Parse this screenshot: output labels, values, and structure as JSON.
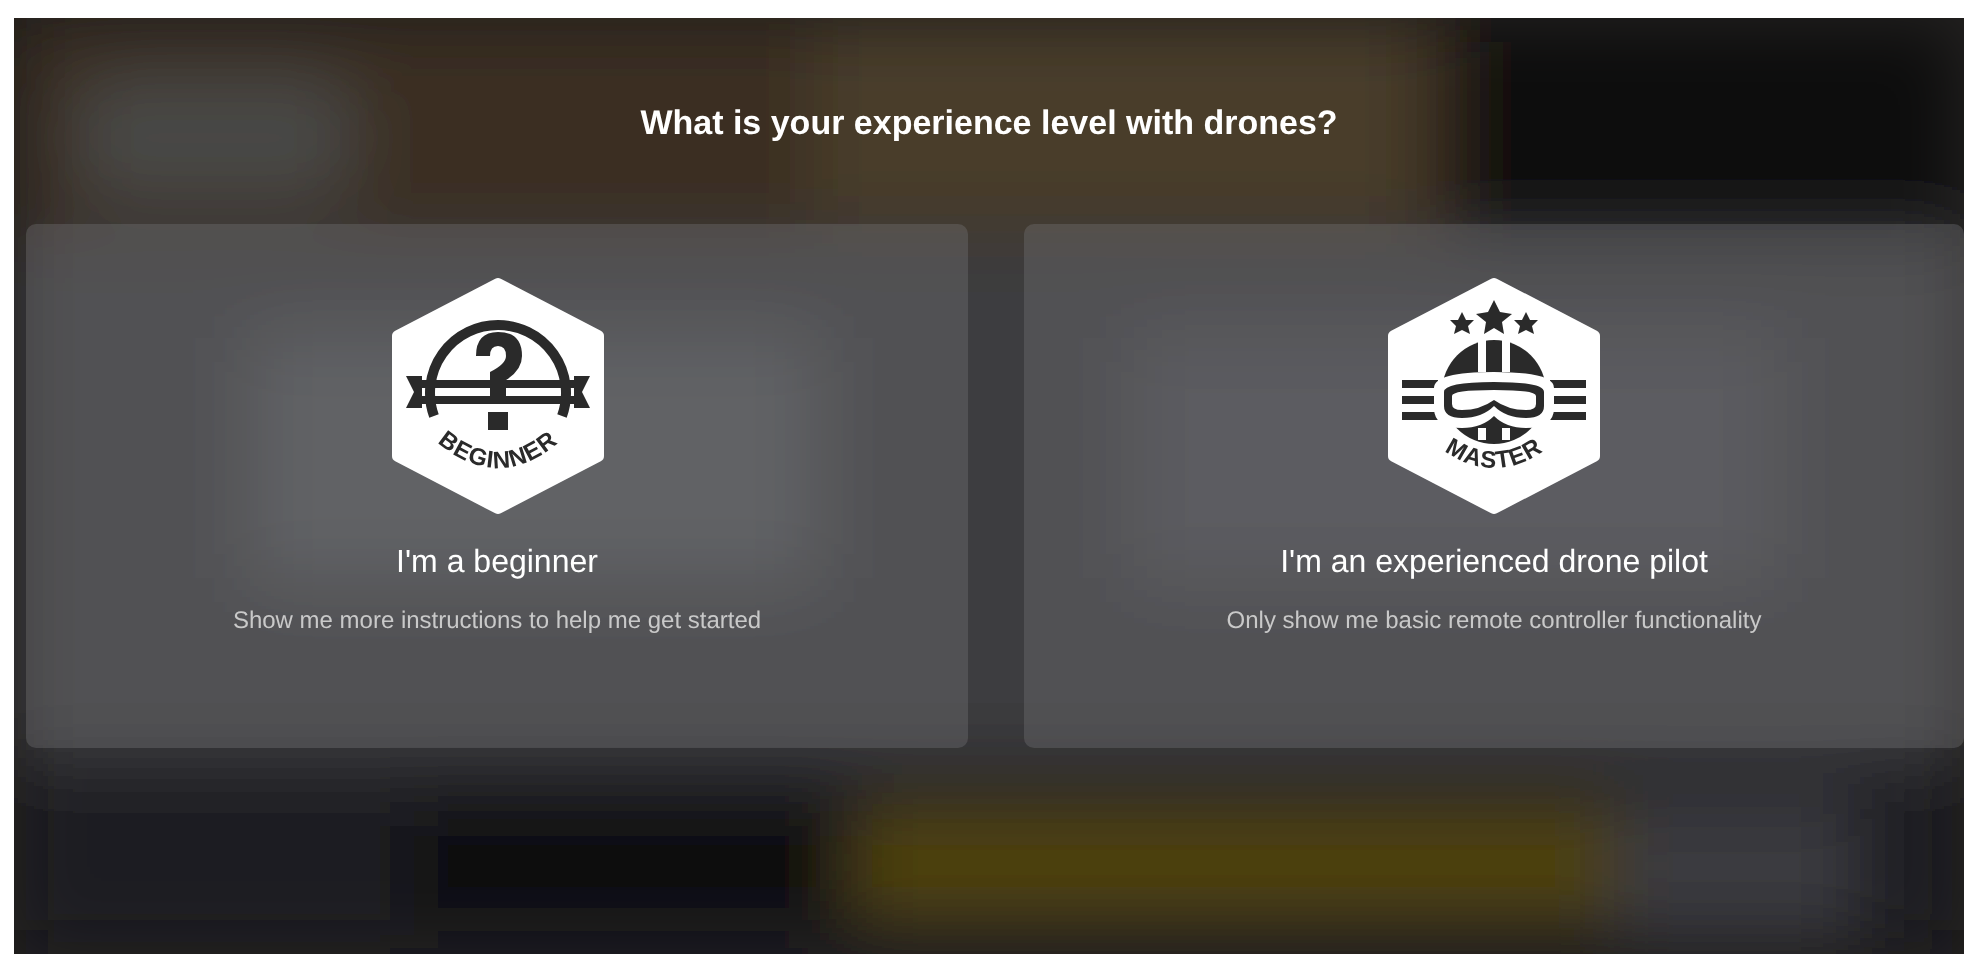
{
  "title": "What is your experience level with drones?",
  "options": [
    {
      "kind": "beginner",
      "badge": "BEGINNER",
      "title": "I'm a beginner",
      "description": "Show me more instructions to help me get started"
    },
    {
      "kind": "master",
      "badge": "MASTER",
      "title": "I'm an experienced drone pilot",
      "description": "Only show me basic remote controller functionality"
    }
  ]
}
